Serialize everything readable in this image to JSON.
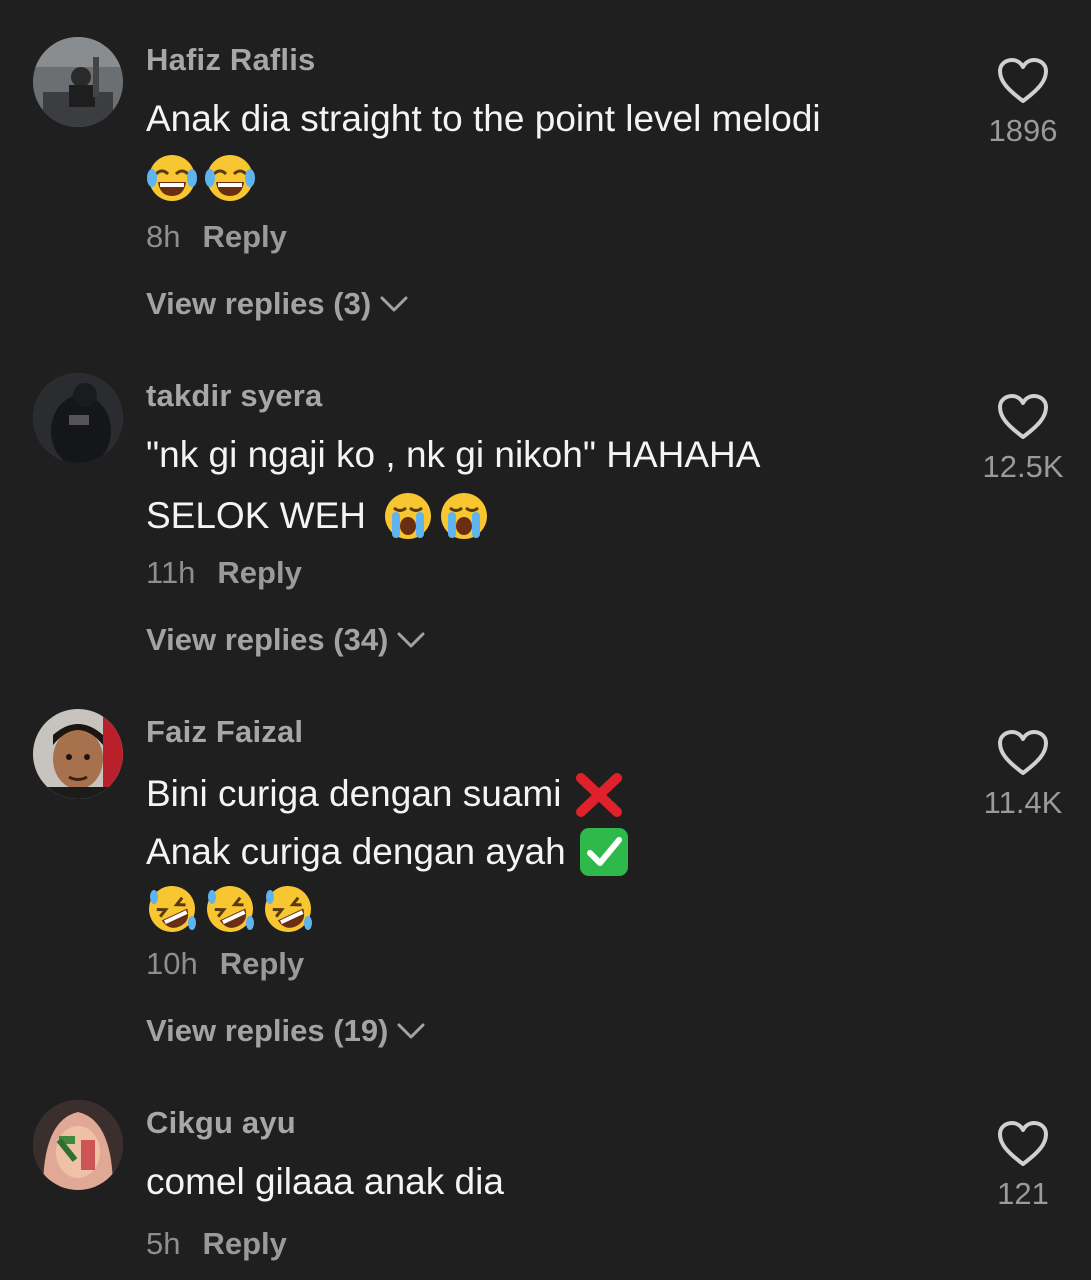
{
  "comments": [
    {
      "username": "Hafiz Raflis",
      "lines": [
        "Anak dia straight to the point level melodi"
      ],
      "emojis": [
        "joy-emoji",
        "joy-emoji"
      ],
      "time": "8h",
      "reply_label": "Reply",
      "view_replies": "View replies (3)",
      "likes": "1896"
    },
    {
      "username": "takdir syera",
      "lines": [
        "\"nk gi ngaji ko , nk gi nikoh\" HAHAHA",
        "SELOK WEH"
      ],
      "emojis": [
        "loudly-crying-emoji",
        "loudly-crying-emoji"
      ],
      "time": "11h",
      "reply_label": "Reply",
      "view_replies": "View replies (34)",
      "likes": "12.5K"
    },
    {
      "username": "Faiz Faizal",
      "lines": [
        "Bini curiga dengan suami",
        "Anak curiga dengan ayah"
      ],
      "emojis": [
        "rofl-emoji",
        "rofl-emoji",
        "rofl-emoji"
      ],
      "line_emojis": [
        "cross-mark-emoji",
        "check-mark-button-emoji"
      ],
      "time": "10h",
      "reply_label": "Reply",
      "view_replies": "View replies (19)",
      "likes": "11.4K"
    },
    {
      "username": "Cikgu ayu",
      "lines": [
        "comel gilaaa anak dia"
      ],
      "time": "5h",
      "reply_label": "Reply",
      "likes": "121"
    }
  ],
  "icons": {
    "like": "heart-outline-icon",
    "expand": "chevron-down-icon"
  },
  "colors": {
    "background": "#1f1f1f",
    "text": "#f4f4f4",
    "secondary": "#9a9a9a"
  }
}
